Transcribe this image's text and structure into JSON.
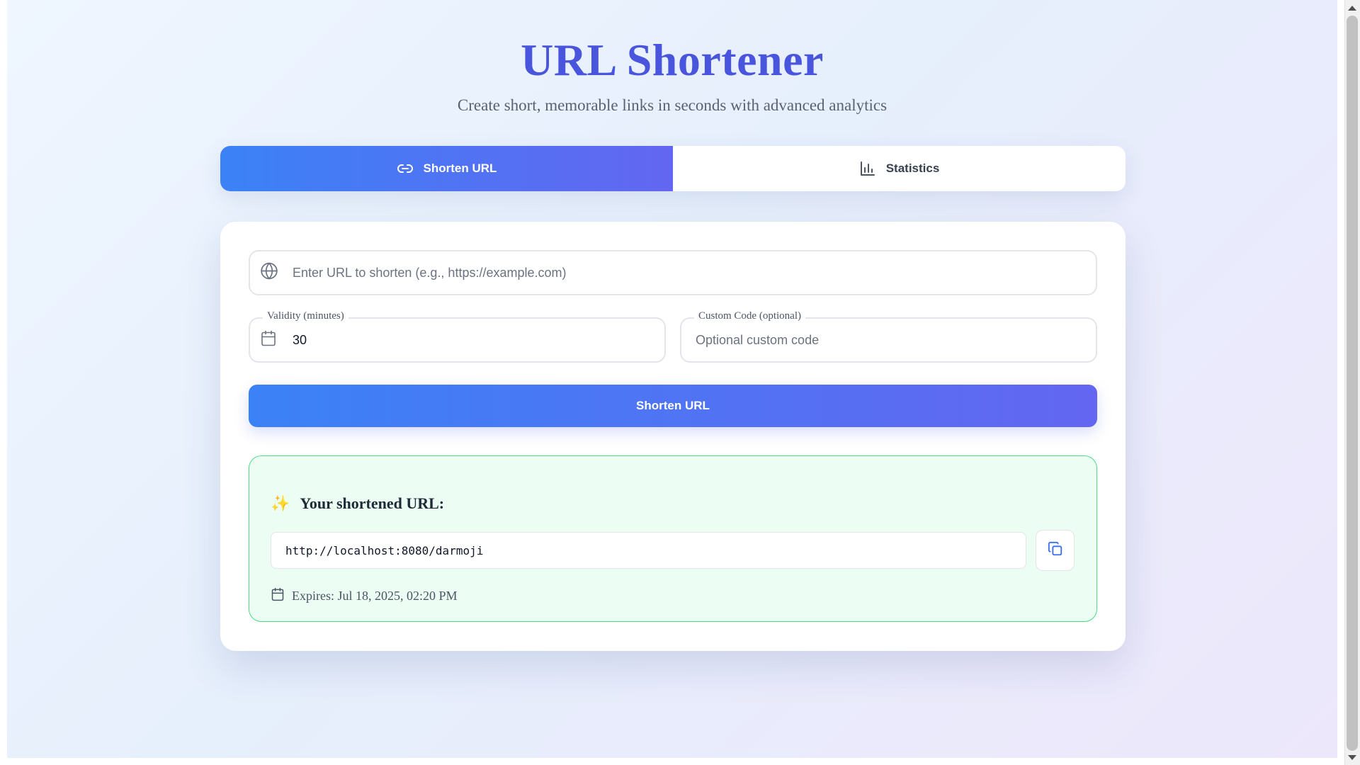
{
  "header": {
    "title": "URL Shortener",
    "subtitle": "Create short, memorable links in seconds with advanced analytics"
  },
  "tabs": [
    {
      "label": "Shorten URL",
      "icon": "link-icon",
      "active": true
    },
    {
      "label": "Statistics",
      "icon": "bar-chart-icon",
      "active": false
    }
  ],
  "form": {
    "url_input": {
      "placeholder": "Enter URL to shorten (e.g., https://example.com)",
      "value": "",
      "icon": "globe-icon"
    },
    "validity": {
      "label": "Validity (minutes)",
      "value": "30",
      "icon": "calendar-icon"
    },
    "custom_code": {
      "label": "Custom Code (optional)",
      "placeholder": "Optional custom code",
      "value": ""
    },
    "submit_label": "Shorten URL"
  },
  "result": {
    "icon": "✨",
    "title": "Your shortened URL:",
    "short_url": "http://localhost:8080/darmoji",
    "copy_icon": "copy-icon",
    "expires_text": "Expires: Jul 18, 2025, 02:20 PM"
  },
  "colors": {
    "title": "#4a55dd",
    "gradient_start": "#3b82f6",
    "gradient_end": "#6366f1",
    "result_bg": "#ecfdf3",
    "result_border": "#4ade80"
  }
}
